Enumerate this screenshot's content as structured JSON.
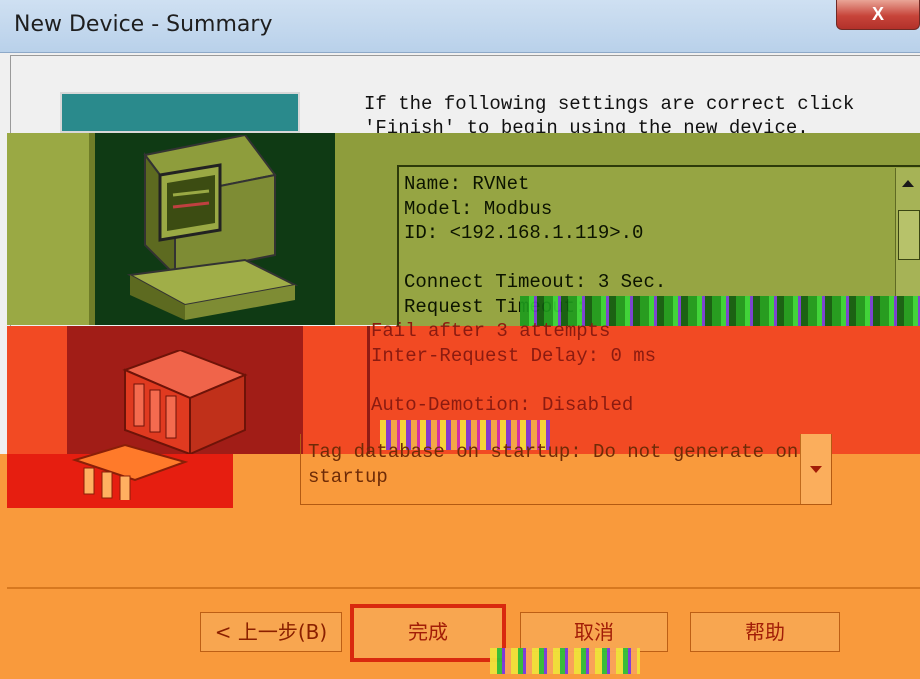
{
  "window": {
    "title": "New Device - Summary",
    "close_label": "X"
  },
  "intro": {
    "line1": "If the following settings are correct click",
    "line2": "'Finish' to begin using the new device."
  },
  "summary": {
    "lines": [
      "Name: RVNet",
      "Model: Modbus",
      "ID: <192.168.1.119>.0",
      "",
      "Connect Timeout: 3 Sec.",
      "Request Timeout:",
      "Fail after 3 attempts",
      "Inter-Request Delay: 0 ms",
      "",
      "Auto-Demotion: Disabled",
      "",
      "Tag database on startup: Do not generate on",
      "startup"
    ]
  },
  "buttons": {
    "back": "< 上一步(B)",
    "finish": "完成",
    "cancel": "取消",
    "help": "帮助"
  },
  "icons": [
    "computer-icon",
    "device-cabinet-icon",
    "scroll-up-icon",
    "scroll-down-icon",
    "scroll-grip-icon"
  ],
  "colors": {
    "band_olive": "#8e9d3c",
    "band_red": "#f24a23",
    "band_orange": "#f99a3c",
    "titlebar": "#c3d7ee"
  }
}
